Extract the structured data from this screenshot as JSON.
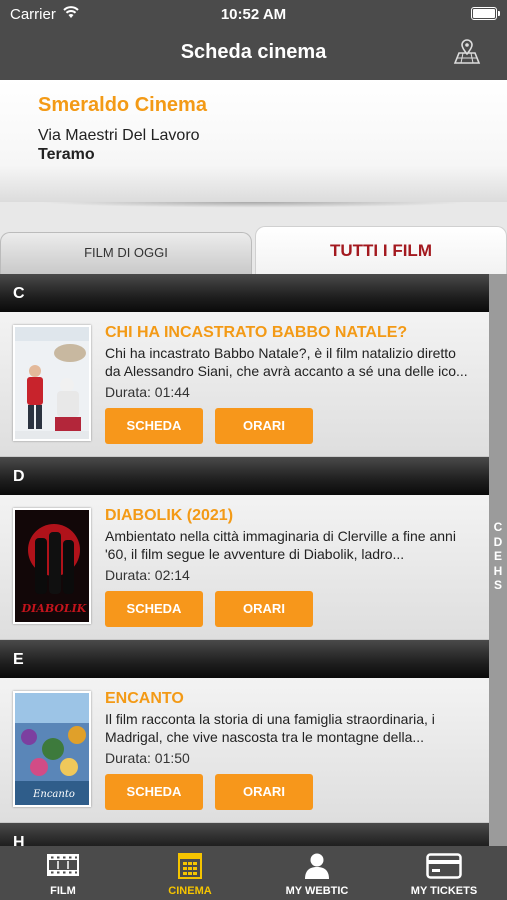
{
  "status_bar": {
    "carrier": "Carrier",
    "time": "10:52 AM"
  },
  "nav": {
    "title": "Scheda cinema",
    "map_icon": "map-location-icon"
  },
  "cinema": {
    "name": "Smeraldo Cinema",
    "street": "Via Maestri Del Lavoro",
    "city": "Teramo"
  },
  "tabs": [
    {
      "label": "FILM DI OGGI",
      "selected": false
    },
    {
      "label": "TUTTI I FILM",
      "selected": true
    }
  ],
  "sections": [
    {
      "letter": "C",
      "films": [
        {
          "title": "CHI HA INCASTRATO BABBO NATALE?",
          "description": "Chi ha incastrato Babbo Natale?, è il film natalizio diretto\nda Alessandro Siani, che avrà accanto a sé una delle ico...",
          "duration": "Durata: 01:44"
        }
      ]
    },
    {
      "letter": "D",
      "films": [
        {
          "title": "DIABOLIK (2021)",
          "description": "Ambientato nella città immaginaria di Clerville a fine anni\n'60, il film segue le avventure di Diabolik, ladro...",
          "duration": "Durata: 02:14"
        }
      ]
    },
    {
      "letter": "E",
      "films": [
        {
          "title": "ENCANTO",
          "description": "Il film racconta la storia di una famiglia straordinaria, i\nMadrigal, che vive nascosta tra le montagne della...",
          "duration": "Durata: 01:50"
        }
      ]
    },
    {
      "letter": "H",
      "films": []
    }
  ],
  "buttons": {
    "scheda": "SCHEDA",
    "orari": "ORARI"
  },
  "index_letters": [
    "C",
    "D",
    "E",
    "H",
    "S"
  ],
  "tabbar": [
    {
      "label": "FILM",
      "icon": "film-strip-icon",
      "active": false
    },
    {
      "label": "CINEMA",
      "icon": "cinema-building-icon",
      "active": true
    },
    {
      "label": "MY WEBTIC",
      "icon": "user-icon",
      "active": false
    },
    {
      "label": "MY TICKETS",
      "icon": "ticket-card-icon",
      "active": false
    }
  ],
  "colors": {
    "accent": "#f39a16",
    "button": "#f7971b",
    "tab_selected_text": "#a3191f",
    "active_tab": "#f5c400",
    "bar": "#4b4b4b"
  }
}
